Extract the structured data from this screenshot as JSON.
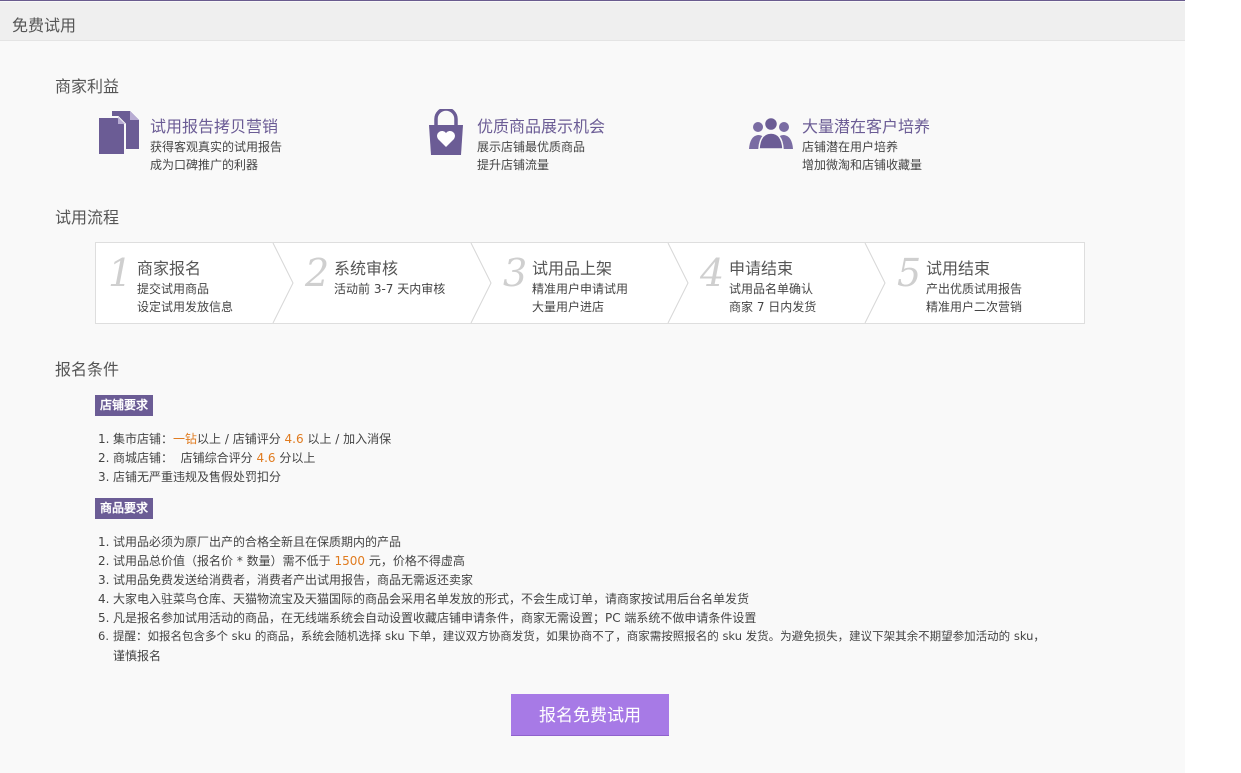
{
  "topbar": {
    "title": "免费试用"
  },
  "sections": {
    "benefits": "商家利益",
    "process": "试用流程",
    "conditions": "报名条件"
  },
  "benefits": [
    {
      "icon": "documents-icon",
      "title": "试用报告拷贝营销",
      "lines": [
        "获得客观真实的试用报告",
        "成为口碑推广的利器"
      ]
    },
    {
      "icon": "shopping-bag-heart-icon",
      "title": "优质商品展示机会",
      "lines": [
        "展示店铺最优质商品",
        "提升店铺流量"
      ]
    },
    {
      "icon": "users-icon",
      "title": "大量潜在客户培养",
      "lines": [
        "店铺潜在用户培养",
        "增加微淘和店铺收藏量"
      ]
    }
  ],
  "steps": [
    {
      "num": "1",
      "title": "商家报名",
      "lines": [
        "提交试用商品",
        "设定试用发放信息"
      ]
    },
    {
      "num": "2",
      "title": "系统审核",
      "lines": [
        "活动前 3-7 天内审核",
        ""
      ]
    },
    {
      "num": "3",
      "title": "试用品上架",
      "lines": [
        "精准用户申请试用",
        "大量用户进店"
      ]
    },
    {
      "num": "4",
      "title": "申请结束",
      "lines": [
        "试用品名单确认",
        "商家 7 日内发货"
      ]
    },
    {
      "num": "5",
      "title": "试用结束",
      "lines": [
        "产出优质试用报告",
        "精准用户二次营销"
      ]
    }
  ],
  "shop_requirements": {
    "tag": "店铺要求",
    "items": [
      {
        "n": "1.",
        "parts": [
          "集市店铺：",
          "一钻",
          "以上 / 店铺评分 ",
          "4.6",
          " 以上 / 加入消保"
        ]
      },
      {
        "n": "2.",
        "parts": [
          "商城店铺：  店铺综合评分 ",
          "4.6",
          " 分以上",
          "",
          ""
        ]
      },
      {
        "n": "3.",
        "parts": [
          "店铺无严重违规及售假处罚扣分",
          "",
          "",
          "",
          ""
        ]
      }
    ]
  },
  "product_requirements": {
    "tag": "商品要求",
    "items": [
      {
        "n": "1.",
        "text": "试用品必须为原厂出产的合格全新且在保质期内的产品"
      },
      {
        "n": "2.",
        "pre": "试用品总价值（报名价 * 数量）需不低于 ",
        "hl": "1500",
        "post": " 元，价格不得虚高"
      },
      {
        "n": "3.",
        "text": "试用品免费发送给消费者，消费者产出试用报告，商品无需返还卖家"
      },
      {
        "n": "4.",
        "text": "大家电入驻菜鸟仓库、天猫物流宝及天猫国际的商品会采用名单发放的形式，不会生成订单，请商家按试用后台名单发货"
      },
      {
        "n": "5.",
        "text": "凡是报名参加试用活动的商品，在无线端系统会自动设置收藏店铺申请条件，商家无需设置；PC 端系统不做申请条件设置"
      },
      {
        "n": "6.",
        "text": "提醒：如报名包含多个 sku 的商品，系统会随机选择 sku 下单，建议双方协商发货，如果协商不了，商家需按照报名的 sku 发货。为避免损失，建议下架其余不期望参加活动的 sku，",
        "cont": "谨慎报名"
      }
    ]
  },
  "cta": {
    "label": "报名免费试用"
  },
  "colors": {
    "accent": "#6b5c95",
    "highlight": "#e07b1f",
    "button": "#a77ae6"
  }
}
